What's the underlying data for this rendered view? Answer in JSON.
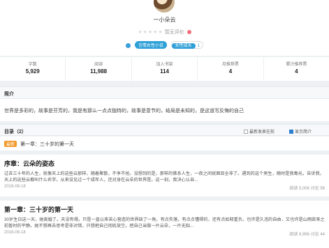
{
  "author": {
    "name": "一小朵云"
  },
  "rating": {
    "label": "暂无评价",
    "stars": "★★★★★"
  },
  "tags": [
    {
      "label": "言情女性小说"
    },
    {
      "label": "女性成长",
      "count": "1"
    }
  ],
  "stats": [
    {
      "label": "字数",
      "value": "5,929"
    },
    {
      "label": "阅读",
      "value": "11,988"
    },
    {
      "label": "加入书架",
      "value": "114"
    },
    {
      "label": "月推荐票",
      "value": "4"
    },
    {
      "label": "累计推荐票",
      "value": "4"
    }
  ],
  "intro": {
    "heading": "简介",
    "text": "世界是多彩的，故事是芬芳的，我是有那么一点点独特的，故事是意节的，结局是未知的，是这道写反悔的自己"
  },
  "catalog": {
    "heading": "目录（2）",
    "opt_latest": "最新发表在前",
    "opt_show_intro": "显示简介",
    "latest_badge": "最新",
    "latest_title": "第一章：三十岁的第一天"
  },
  "posts": [
    {
      "title": "序章：云朵的姿态",
      "excerpt": "过去三十年的人生，就像天上的这些云那样，随着聚散，不争不抢。没想到的是，那样的佛系人生，一夜之间就面目全非了。遇到的这个男生，随时是我毒光，告诉我，天上的这些云都叫什么名字。从来没见过一个成年人，还对身在云朵的世界是。这一刻，我决心认自...",
      "date": "2019-09-18",
      "stats": "阅读 5,006  讨论 58"
    },
    {
      "title": "第一章：三十岁的第一天",
      "excerpt": "30岁生日这一天，她离婚了。天没有塌，只是一直以来苦心营造的世界缺了一角，有点失落，有点点懂得的，还有点如释重负。也许是久违的自由，又也许是山雨欲来之前暂时的平静。她不想再去思考是非对错，只想把自己彻底放空。把自己当做一片云朵，一片无知...",
      "date": "2019-09-18",
      "stats": "阅读 6,996  讨论 44"
    }
  ],
  "colors": {
    "accent": "#2e9fd7",
    "badge": "#f39a2c",
    "background": "#eef1f4"
  }
}
